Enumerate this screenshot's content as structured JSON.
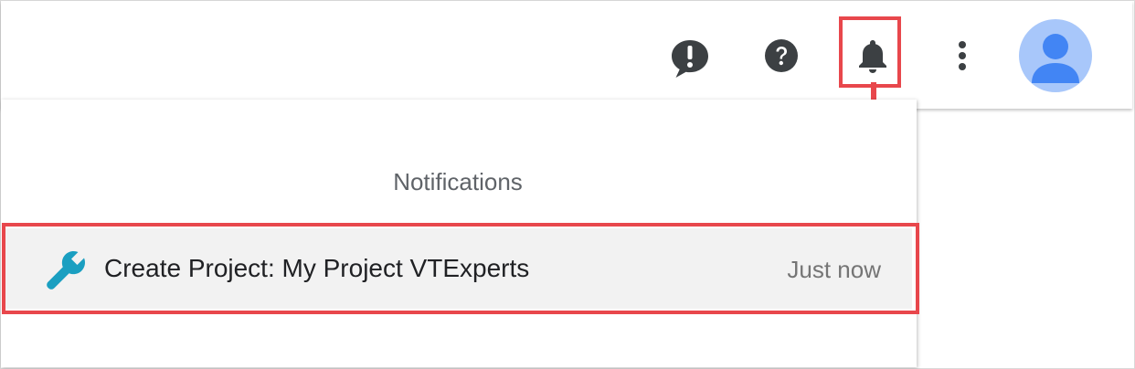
{
  "topbar": {
    "icons": {
      "feedback": "feedback-icon",
      "help": "help-icon",
      "notifications": "bell-icon",
      "more": "more-vert-icon",
      "avatar": "account-avatar"
    }
  },
  "notifications": {
    "title": "Notifications",
    "items": [
      {
        "icon": "wrench-icon",
        "text": "Create Project: My Project VTExperts",
        "time": "Just now"
      }
    ]
  },
  "colors": {
    "highlight": "#e8474c",
    "icon_dark": "#3c4043",
    "wrench": "#1a9fc1",
    "avatar_bg": "#a8c7fa",
    "avatar_fg": "#4285f4",
    "row_bg": "#f2f2f2"
  }
}
